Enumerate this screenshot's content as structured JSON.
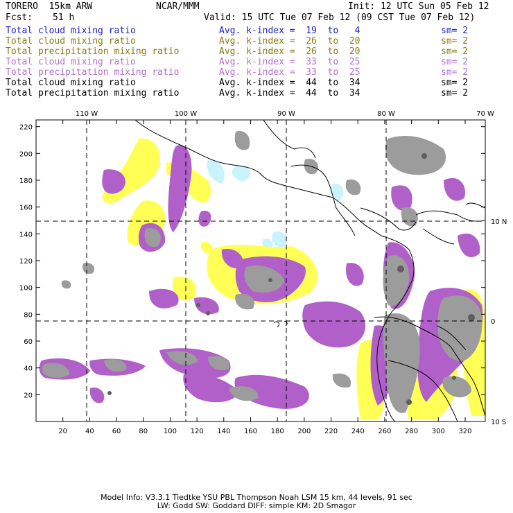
{
  "header": {
    "model": "TORERO  15km ARW",
    "center": "NCAR/MMM",
    "init": "Init: 12 UTC Sun 05 Feb 12",
    "fcst_label": "Fcst:",
    "fcst_value": "51 h",
    "valid": "Valid: 15 UTC Tue 07 Feb 12 (09 CST Tue 07 Feb 12)"
  },
  "legend": [
    {
      "field": "Total cloud mixing ratio",
      "avg": "Avg. k-index =  19  to   4",
      "sm": "sm= 2",
      "color": "#1a1acc"
    },
    {
      "field": "Total cloud mixing ratio",
      "avg": "Avg. k-index =  26  to  20",
      "sm": "sm= 2",
      "color": "#8a7a10"
    },
    {
      "field": "Total precipitation mixing ratio",
      "avg": "Avg. k-index =  26  to  20",
      "sm": "sm= 2",
      "color": "#8a7a10"
    },
    {
      "field": "Total cloud mixing ratio",
      "avg": "Avg. k-index =  33  to  25",
      "sm": "sm= 2",
      "color": "#b36fd0"
    },
    {
      "field": "Total precipitation mixing ratio",
      "avg": "Avg. k-index =  33  to  25",
      "sm": "sm= 2",
      "color": "#b36fd0"
    },
    {
      "field": "Total cloud mixing ratio",
      "avg": "Avg. k-index =  44  to  34",
      "sm": "sm= 2",
      "color": "#000000"
    },
    {
      "field": "Total precipitation mixing ratio",
      "avg": "Avg. k-index =  44  to  34",
      "sm": "sm= 2",
      "color": "#000000"
    }
  ],
  "map": {
    "x_ticks": [
      "20",
      "40",
      "60",
      "80",
      "100",
      "120",
      "140",
      "160",
      "180",
      "200",
      "220",
      "240",
      "260",
      "280",
      "300",
      "320"
    ],
    "y_ticks": [
      "20",
      "40",
      "60",
      "80",
      "100",
      "120",
      "140",
      "160",
      "180",
      "200",
      "220"
    ],
    "lon_labels": [
      "110 W",
      "100 W",
      "90 W",
      "80 W",
      "70 W"
    ],
    "lat_labels": [
      "10 N",
      "0",
      "10 S"
    ],
    "colors": {
      "grey": "#9c9c9c",
      "dark": "#5e5e5e",
      "purple": "#b060c8",
      "yellow": "#ffff55",
      "cyan": "#c9f3ff"
    }
  },
  "footer": {
    "line1": "Model Info: V3.3.1   Tiedtke YSU PBL  Thompson    Noah LSM  15 km,   44 levels,   91 sec",
    "line2": "LW: Godd SW: Goddard DIFF: simple KM: 2D Smagor"
  }
}
